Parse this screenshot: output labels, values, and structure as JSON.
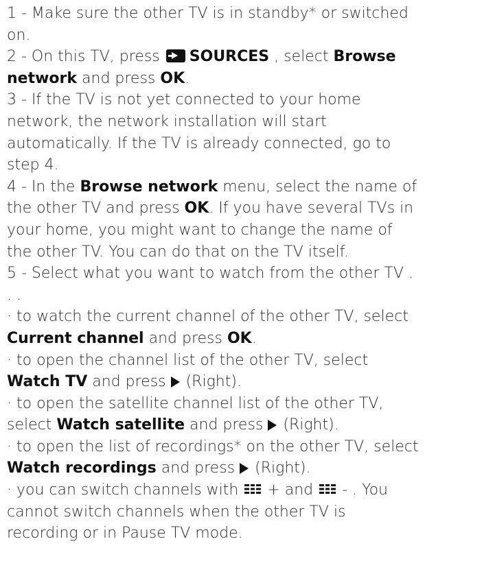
{
  "steps": {
    "s1_a": "1 - Make sure the other TV is in standby* or switched",
    "s1_b": "on.",
    "s2_a_pre": "2 - On this TV, press ",
    "s2_a_key": "SOURCES",
    "s2_a_mid": " , select ",
    "s2_a_bold": "Browse",
    "s2_b_bold": "network",
    "s2_b_mid": " and press ",
    "s2_b_ok": "OK",
    "s2_b_end": ".",
    "s3_a": "3 - If the TV is not yet connected to your home",
    "s3_b": "network, the network installation will start",
    "s3_c": "automatically. If the TV is already connected, go to",
    "s3_d": "step 4.",
    "s4_a_pre": "4 - In the ",
    "s4_a_bold": "Browse network",
    "s4_a_end": " menu, select the name of",
    "s4_b_pre": "the other TV and press ",
    "s4_b_ok": "OK",
    "s4_b_end": ". If you have several TVs in",
    "s4_c": "your home, you might want to change the name of",
    "s4_d": "the other TV. You can do that on the TV itself.",
    "s5_a": "5 - Select what you want to watch from the other TV .",
    "s5_b": ". ."
  },
  "bullets": {
    "b1_a": "· to watch the current channel of the other TV, select",
    "b1_b_bold": "Current channel",
    "b1_b_mid": " and press ",
    "b1_b_ok": "OK",
    "b1_b_end": ".",
    "b2_a": "· to open the channel list of the other TV, select",
    "b2_b_bold": "Watch TV",
    "b2_b_mid": " and press ",
    "b2_b_end": " (Right).",
    "b3_a": "· to open the satellite channel list of the other TV,",
    "b3_b_pre": "select ",
    "b3_b_bold": "Watch satellite",
    "b3_b_mid": " and press ",
    "b3_b_end": " (Right).",
    "b4_a": "· to open the list of recordings* on the other TV, select",
    "b4_b_bold": "Watch recordings",
    "b4_b_mid": " and press ",
    "b4_b_end": " (Right).",
    "b5_a_pre": "· you can switch channels with ",
    "b5_a_plus": " +  and ",
    "b5_a_minus": " - . You",
    "b5_b": "cannot switch channels when the other TV is",
    "b5_c": "recording or in Pause TV mode."
  }
}
